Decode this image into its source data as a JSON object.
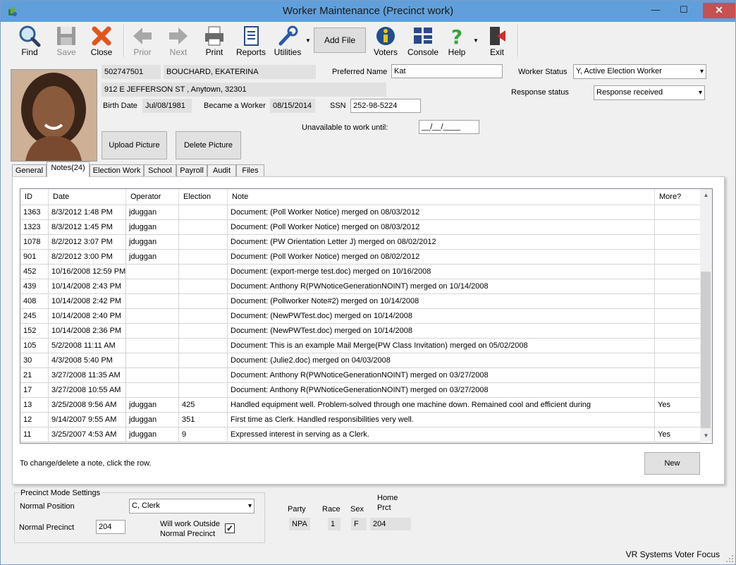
{
  "window": {
    "title": "Worker Maintenance (Precinct work)",
    "minimize": "—",
    "maximize": "☐",
    "close": "✕"
  },
  "toolbar": {
    "find": "Find",
    "save": "Save",
    "close": "Close",
    "prior": "Prior",
    "next": "Next",
    "print": "Print",
    "reports": "Reports",
    "utilities": "Utilities",
    "add_file": "Add File",
    "voters": "Voters",
    "console": "Console",
    "help": "Help",
    "exit": "Exit"
  },
  "worker": {
    "id": "502747501",
    "name": "BOUCHARD, EKATERINA",
    "address": "912 E JEFFERSON ST , Anytown, 32301",
    "birth_date_label": "Birth Date",
    "birth_date": "Jul/08/1981",
    "became_label": "Became a Worker",
    "became_date": "08/15/2014",
    "ssn_label": "SSN",
    "ssn": "252-98-5224",
    "preferred_name_label": "Preferred Name",
    "preferred_name": "Kat",
    "worker_status_label": "Worker Status",
    "worker_status": "Y, Active Election Worker",
    "response_status_label": "Response status",
    "response_status": "Response received",
    "unavailable_label": "Unavailable to work until:",
    "unavailable_value": "__/__/____",
    "upload_picture": "Upload Picture",
    "delete_picture": "Delete Picture"
  },
  "tabs": [
    "General",
    "Notes(24)",
    "Election Work",
    "School",
    "Payroll",
    "Audit",
    "Files"
  ],
  "notes": {
    "columns": [
      "ID",
      "Date",
      "Operator",
      "Election",
      "Note",
      "More?"
    ],
    "rows": [
      [
        "1363",
        "8/3/2012 1:48 PM",
        "jduggan",
        "",
        "Document: (Poll Worker Notice) merged on 08/03/2012",
        ""
      ],
      [
        "1323",
        "8/3/2012 1:45 PM",
        "jduggan",
        "",
        "Document: (Poll Worker Notice) merged on 08/03/2012",
        ""
      ],
      [
        "1078",
        "8/2/2012 3:07 PM",
        "jduggan",
        "",
        "Document: (PW Orientation Letter J) merged on 08/02/2012",
        ""
      ],
      [
        "901",
        "8/2/2012 3:00 PM",
        "jduggan",
        "",
        "Document: (Poll Worker Notice) merged on 08/02/2012",
        ""
      ],
      [
        "452",
        "10/16/2008 12:59 PM",
        "",
        "",
        "Document: (export-merge test.doc) merged on 10/16/2008",
        ""
      ],
      [
        "439",
        "10/14/2008 2:43 PM",
        "",
        "",
        "Document: Anthony R(PWNoticeGenerationNOINT) merged on 10/14/2008",
        ""
      ],
      [
        "408",
        "10/14/2008 2:42 PM",
        "",
        "",
        "Document: (Pollworker Note#2) merged on 10/14/2008",
        ""
      ],
      [
        "245",
        "10/14/2008 2:40 PM",
        "",
        "",
        "Document: (NewPWTest.doc) merged on 10/14/2008",
        ""
      ],
      [
        "152",
        "10/14/2008 2:36 PM",
        "",
        "",
        "Document: (NewPWTest.doc) merged on 10/14/2008",
        ""
      ],
      [
        "105",
        "5/2/2008 11:11 AM",
        "",
        "",
        "Document: This is an example Mail Merge(PW Class Invitation) merged on 05/02/2008",
        ""
      ],
      [
        "30",
        "4/3/2008 5:40 PM",
        "",
        "",
        "Document: (Julie2.doc) merged on 04/03/2008",
        ""
      ],
      [
        "21",
        "3/27/2008 11:35 AM",
        "",
        "",
        "Document: Anthony R(PWNoticeGenerationNOINT) merged on 03/27/2008",
        ""
      ],
      [
        "17",
        "3/27/2008 10:55 AM",
        "",
        "",
        "Document: Anthony R(PWNoticeGenerationNOINT) merged on 03/27/2008",
        ""
      ],
      [
        "13",
        "3/25/2008 9:56 AM",
        "jduggan",
        "425",
        "Handled equipment well. Problem-solved through one machine down. Remained cool and efficient during",
        "Yes"
      ],
      [
        "12",
        "9/14/2007 9:55 AM",
        "jduggan",
        "351",
        "First time as Clerk. Handled responsibilities very well.",
        ""
      ],
      [
        "11",
        "3/25/2007 4:53 AM",
        "jduggan",
        "9",
        "Expressed interest in serving as a Clerk.",
        "Yes"
      ]
    ],
    "hint": "To change/delete a note, click the row.",
    "new_button": "New"
  },
  "precinct": {
    "legend": "Precinct Mode Settings",
    "normal_position_label": "Normal Position",
    "normal_position": "C, Clerk",
    "normal_precinct_label": "Normal Precinct",
    "normal_precinct": "204",
    "outside_label_1": "Will work Outside",
    "outside_label_2": "Normal Precinct",
    "outside_checked": "✓"
  },
  "demographics": {
    "party_label": "Party",
    "party": "NPA",
    "race_label": "Race",
    "race": "1",
    "sex_label": "Sex",
    "sex": "F",
    "home_prct_label_1": "Home",
    "home_prct_label_2": "Prct",
    "home_prct": "204"
  },
  "status_bar": "VR Systems Voter Focus"
}
